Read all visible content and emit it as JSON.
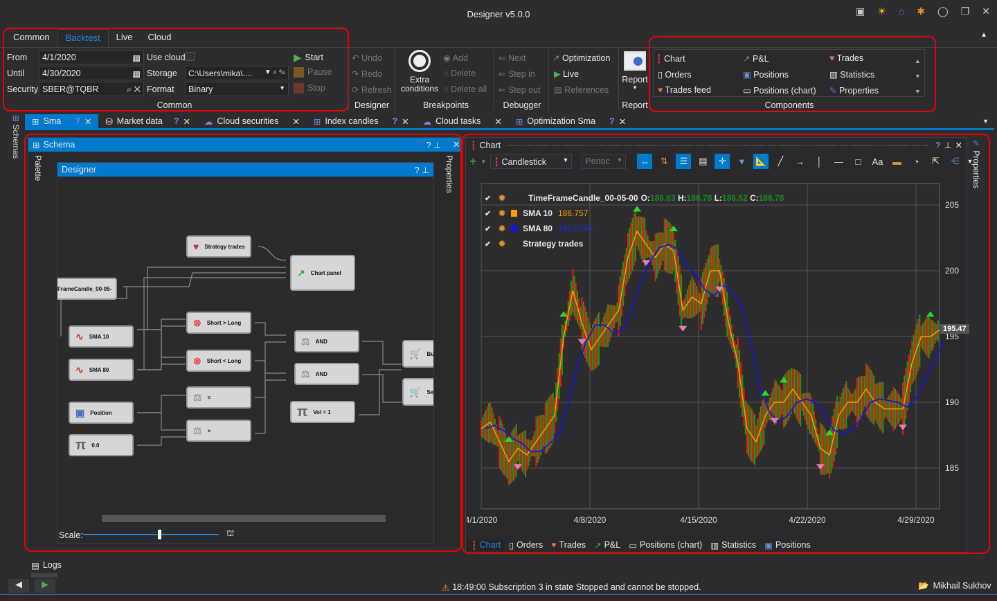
{
  "window": {
    "title": "Designer v5.0.0"
  },
  "ribbon": {
    "tabs": [
      "Common",
      "Backtest",
      "Live",
      "Cloud"
    ],
    "active_tab": "Backtest",
    "common": {
      "from_label": "From",
      "from_value": "4/1/2020",
      "until_label": "Until",
      "until_value": "4/30/2020",
      "security_label": "Security",
      "security_value": "SBER@TQBR",
      "use_cloud_label": "Use cloud",
      "storage_label": "Storage",
      "storage_value": "C:\\Users\\mika\\....",
      "format_label": "Format",
      "format_value": "Binary",
      "start": "Start",
      "pause": "Pause",
      "stop": "Stop",
      "group": "Common"
    },
    "designer": {
      "undo": "Undo",
      "redo": "Redo",
      "refresh": "Refresh",
      "group": "Designer"
    },
    "breakpoints": {
      "extra": "Extra conditions",
      "add": "Add",
      "delete": "Delete",
      "delete_all": "Delete all",
      "group": "Breakpoints"
    },
    "debugger": {
      "next": "Next",
      "step_in": "Step in",
      "step_out": "Step out",
      "group": "Debugger"
    },
    "run": {
      "optimization": "Optimization",
      "live": "Live",
      "references": "References"
    },
    "report": {
      "label": "Report",
      "group": "Report"
    },
    "components": {
      "items": [
        "Chart",
        "P&L",
        "Trades",
        "Orders",
        "Positions",
        "Statistics",
        "Trades feed",
        "Positions (chart)",
        "Properties"
      ],
      "group": "Components"
    }
  },
  "doc_tabs": [
    "Sma",
    "Market data",
    "Cloud securities",
    "Index candles",
    "Cloud tasks",
    "Optimization Sma"
  ],
  "side": {
    "schemas": "Schemas",
    "palette": "Palette",
    "properties": "Properties"
  },
  "schema": {
    "title": "Schema",
    "designer_title": "Designer",
    "scale_label": "Scale:",
    "scale_value": 0.55,
    "nodes": {
      "strategy_trades": "Strategy trades",
      "chart_panel": "Chart panel",
      "candles": "FrameCandle_00-05-",
      "sma10": "SMA 10",
      "sma80": "SMA 80",
      "short_gt_long": "Short > Long",
      "short_lt_long": "Short < Long",
      "and1": "AND",
      "and2": "AND",
      "eq": "=",
      "gt": ">",
      "position": "Position",
      "zero": "0.0",
      "vol": "Vol = 1",
      "buy": "Buy",
      "sell": "Sell"
    }
  },
  "chart_panel": {
    "title": "Chart",
    "chart_type": "Candlestick",
    "period": "Perioc",
    "legend": {
      "candles": "TimeFrameCandle_00-05-00",
      "o_label": "O:",
      "o": "186.63",
      "h_label": "H:",
      "h": "186.78",
      "l_label": "L:",
      "l": "186.52",
      "c_label": "C:",
      "c": "186.78",
      "sma10": "SMA 10",
      "sma10_value": "186.757",
      "sma80": "SMA 80",
      "sma80_value": "185.6746",
      "trades": "Strategy trades"
    },
    "last_price": "195.47",
    "bottom_tabs": [
      "Chart",
      "Orders",
      "Trades",
      "P&L",
      "Positions (chart)",
      "Statistics",
      "Positions"
    ]
  },
  "chart_data": {
    "type": "line",
    "x_ticks": [
      "4/1/2020",
      "4/8/2020",
      "4/15/2020",
      "4/22/2020",
      "4/29/2020"
    ],
    "y_ticks": [
      185,
      190,
      195,
      200,
      205
    ],
    "ylim": [
      182,
      208
    ],
    "grid": true,
    "series": [
      {
        "name": "SMA 10",
        "color": "#ff9900",
        "values": [
          188,
          188.5,
          187,
          185.5,
          186.5,
          186,
          187,
          188,
          189,
          195,
          198.5,
          196,
          194,
          195,
          196,
          197,
          201,
          203,
          202,
          201,
          202,
          201.5,
          197,
          198,
          197.5,
          200,
          200,
          196,
          193,
          188,
          187,
          189,
          190,
          190,
          191,
          190,
          189,
          186.5,
          186,
          189,
          190,
          190,
          191,
          190,
          189.5,
          189.5,
          189.5,
          193,
          195,
          195,
          195.5
        ]
      }
    ],
    "sma80_color": "#1515e0",
    "buy_color": "#22dd22",
    "sell_color": "#ee77bb"
  },
  "logs": "Logs",
  "status": {
    "message": "18:49:00  Subscription 3 in state Stopped and cannot be stopped.",
    "user": "Mikhail Sukhov"
  }
}
